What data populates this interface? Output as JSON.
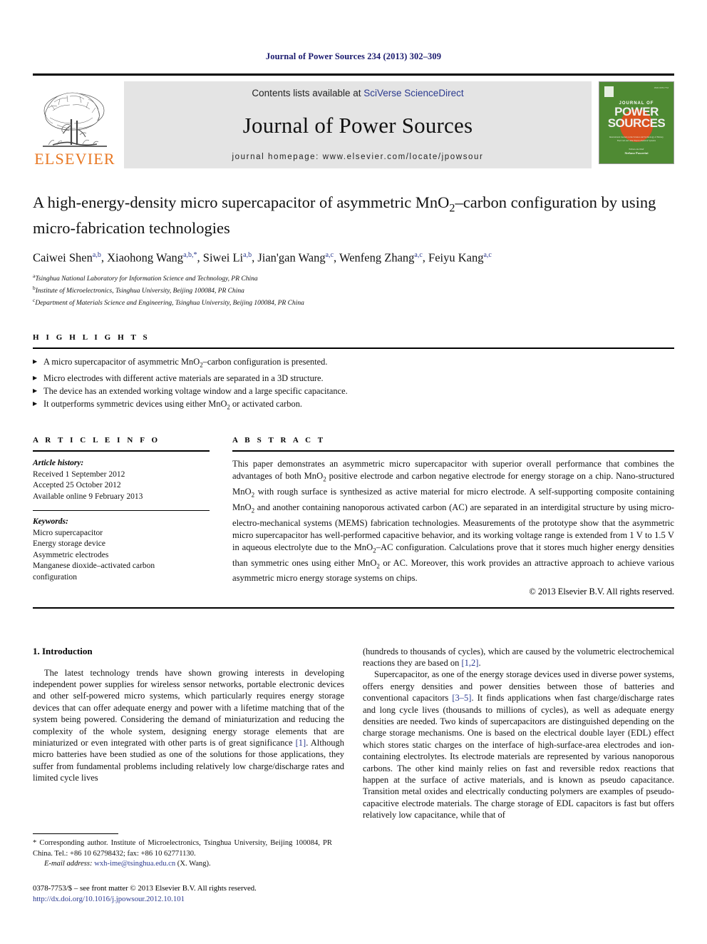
{
  "running_head": "Journal of Power Sources 234 (2013) 302–309",
  "masthead": {
    "contents_prefix": "Contents lists available at ",
    "sciencedirect": "SciVerse ScienceDirect",
    "journal_title": "Journal of Power Sources",
    "homepage": "journal homepage: www.elsevier.com/locate/jpowsour",
    "publisher_wordmark": "ELSEVIER",
    "cover": {
      "line1": "JOURNAL OF",
      "line2": "POWER",
      "line3": "SOURCES",
      "tagline": "International Journal on the Science and Technology of Battery, Fuel Cell and other Electrochemical Systems",
      "editors": "Editors-in-Chief",
      "editor_names": "Stefano Passerini"
    }
  },
  "article": {
    "title_line1": "A high-energy-density micro supercapacitor of asymmetric MnO₂–carbon",
    "title_line2": "configuration by using micro-fabrication technologies",
    "title_full": "A high-energy-density micro supercapacitor of asymmetric MnO2–carbon configuration by using micro-fabrication technologies",
    "authors": [
      {
        "name": "Caiwei Shen",
        "marks": "a,b",
        "corresponding": false
      },
      {
        "name": "Xiaohong Wang",
        "marks": "a,b,",
        "corresponding": true
      },
      {
        "name": "Siwei Li",
        "marks": "a,b",
        "corresponding": false
      },
      {
        "name": "Jian'gan Wang",
        "marks": "a,c",
        "corresponding": false
      },
      {
        "name": "Wenfeng Zhang",
        "marks": "a,c",
        "corresponding": false
      },
      {
        "name": "Feiyu Kang",
        "marks": "a,c",
        "corresponding": false
      }
    ],
    "affiliations": [
      {
        "mark": "a",
        "text": "Tsinghua National Laboratory for Information Science and Technology, PR China"
      },
      {
        "mark": "b",
        "text": "Institute of Microelectronics, Tsinghua University, Beijing 100084, PR China"
      },
      {
        "mark": "c",
        "text": "Department of Materials Science and Engineering, Tsinghua University, Beijing 100084, PR China"
      }
    ]
  },
  "highlights": {
    "heading": "H I G H L I G H T S",
    "items": [
      "A micro supercapacitor of asymmetric MnO2–carbon configuration is presented.",
      "Micro electrodes with different active materials are separated in a 3D structure.",
      "The device has an extended working voltage window and a large specific capacitance.",
      "It outperforms symmetric devices using either MnO2 or activated carbon."
    ]
  },
  "article_info": {
    "heading": "A R T I C L E   I N F O",
    "history_label": "Article history:",
    "history": [
      "Received 1 September 2012",
      "Accepted 25 October 2012",
      "Available online 9 February 2013"
    ],
    "keywords_label": "Keywords:",
    "keywords": [
      "Micro supercapacitor",
      "Energy storage device",
      "Asymmetric electrodes",
      "Manganese dioxide–activated carbon",
      "configuration"
    ]
  },
  "abstract": {
    "heading": "A B S T R A C T",
    "text": "This paper demonstrates an asymmetric micro supercapacitor with superior overall performance that combines the advantages of both MnO2 positive electrode and carbon negative electrode for energy storage on a chip. Nano-structured MnO2 with rough surface is synthesized as active material for micro electrode. A self-supporting composite containing MnO2 and another containing nanoporous activated carbon (AC) are separated in an interdigital structure by using micro-electro-mechanical systems (MEMS) fabrication technologies. Measurements of the prototype show that the asymmetric micro supercapacitor has well-performed capacitive behavior, and its working voltage range is extended from 1 V to 1.5 V in aqueous electrolyte due to the MnO2–AC configuration. Calculations prove that it stores much higher energy densities than symmetric ones using either MnO2 or AC. Moreover, this work provides an attractive approach to achieve various asymmetric micro energy storage systems on chips.",
    "copyright": "© 2013 Elsevier B.V. All rights reserved."
  },
  "body": {
    "section_number_title": "1.  Introduction",
    "left_paragraph": "The latest technology trends have shown growing interests in developing independent power supplies for wireless sensor networks, portable electronic devices and other self-powered micro systems, which particularly requires energy storage devices that can offer adequate energy and power with a lifetime matching that of the system being powered. Considering the demand of miniaturization and reducing the complexity of the whole system, designing energy storage elements that are miniaturized or even integrated with other parts is of great significance [1]. Although micro batteries have been studied as one of the solutions for those applications, they suffer from fundamental problems including relatively low charge/discharge rates and limited cycle lives",
    "right_paragraph_1": "(hundreds to thousands of cycles), which are caused by the volumetric electrochemical reactions they are based on [1,2].",
    "right_paragraph_2": "Supercapacitor, as one of the energy storage devices used in diverse power systems, offers energy densities and power densities between those of batteries and conventional capacitors [3–5]. It finds applications when fast charge/discharge rates and long cycle lives (thousands to millions of cycles), as well as adequate energy densities are needed. Two kinds of supercapacitors are distinguished depending on the charge storage mechanisms. One is based on the electrical double layer (EDL) effect which stores static charges on the interface of high-surface-area electrodes and ion-containing electrolytes. Its electrode materials are represented by various nanoporous carbons. The other kind mainly relies on fast and reversible redox reactions that happen at the surface of active materials, and is known as pseudo capacitance. Transition metal oxides and electrically conducting polymers are examples of pseudo-capacitive electrode materials. The charge storage of EDL capacitors is fast but offers relatively low capacitance, while that of"
  },
  "footnote": {
    "corresponding": "* Corresponding author. Institute of Microelectronics, Tsinghua University, Beijing 100084, PR China. Tel.: +86 10 62798432; fax: +86 10 62771130.",
    "email_label": "E-mail address:",
    "email": "wxh-ime@tsinghua.edu.cn",
    "email_attrib": "(X. Wang).",
    "issn_line": "0378-7753/$ – see front matter © 2013 Elsevier B.V. All rights reserved.",
    "doi": "http://dx.doi.org/10.1016/j.jpowsour.2012.10.101"
  },
  "colors": {
    "link_blue": "#2b3a8f",
    "elsevier_orange": "#E87722",
    "cover_green": "#4f8a33",
    "masthead_grey": "#e4e4e4"
  }
}
